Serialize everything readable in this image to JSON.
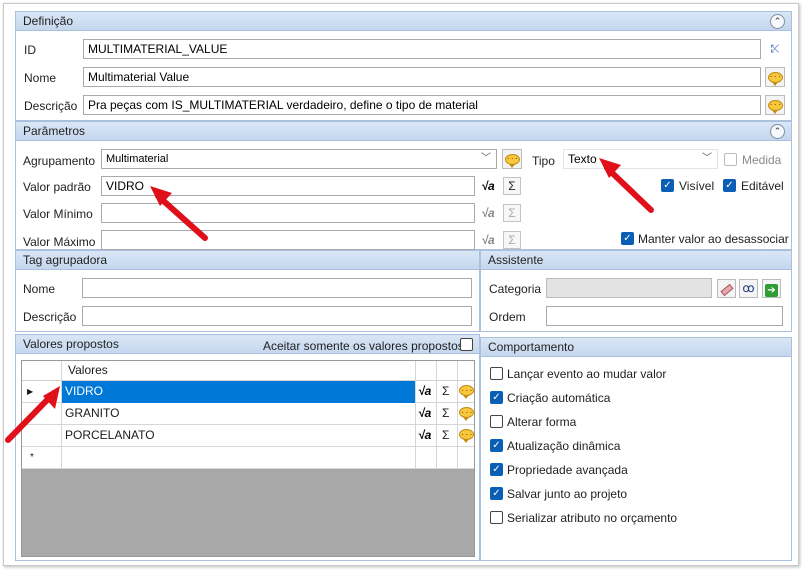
{
  "definicao": {
    "title": "Definição",
    "id_label": "ID",
    "id_value": "MULTIMATERIAL_VALUE",
    "nome_label": "Nome",
    "nome_value": "Multimaterial Value",
    "descricao_label": "Descrição",
    "descricao_value": "Pra peças com IS_MULTIMATERIAL verdadeiro, define o tipo de material"
  },
  "parametros": {
    "title": "Parâmetros",
    "agrupamento_label": "Agrupamento",
    "agrupamento_value": "Multimaterial",
    "tipo_label": "Tipo",
    "tipo_value": "Texto",
    "medida_label": "Medida",
    "valor_padrao_label": "Valor padrão",
    "valor_padrao_value": "VIDRO",
    "valor_minimo_label": "Valor Mínimo",
    "valor_maximo_label": "Valor Máximo",
    "visivel_label": "Visível",
    "editavel_label": "Editável",
    "manter_label": "Manter valor ao desassociar"
  },
  "tag": {
    "title": "Tag agrupadora",
    "nome_label": "Nome",
    "descricao_label": "Descrição"
  },
  "assistente": {
    "title": "Assistente",
    "categoria_label": "Categoria",
    "ordem_label": "Ordem"
  },
  "valores": {
    "title": "Valores propostos",
    "aceitar_label": "Aceitar somente os valores propostos",
    "column_header": "Valores",
    "rows": [
      "VIDRO",
      "GRANITO",
      "PORCELANATO"
    ],
    "new_row_marker": "*"
  },
  "comportamento": {
    "title": "Comportamento",
    "items": [
      {
        "label": "Lançar evento ao mudar valor",
        "checked": false
      },
      {
        "label": "Criação automática",
        "checked": true
      },
      {
        "label": "Alterar forma",
        "checked": false
      },
      {
        "label": "Atualização dinâmica",
        "checked": true
      },
      {
        "label": "Propriedade avançada",
        "checked": true
      },
      {
        "label": "Salvar junto ao projeto",
        "checked": true
      },
      {
        "label": "Serializar atributo no orçamento",
        "checked": false
      }
    ]
  },
  "colors": {
    "accent": "#0a5fb4",
    "selected_row": "#0078d7",
    "header_bg": "#d9e6f6",
    "annotation_arrow": "#e0101a"
  },
  "icons": {
    "collapse": "double-chevron-up-icon",
    "chat": "speech-bubble-icon",
    "formula": "sqrt-formula-icon",
    "sigma": "sigma-icon"
  }
}
